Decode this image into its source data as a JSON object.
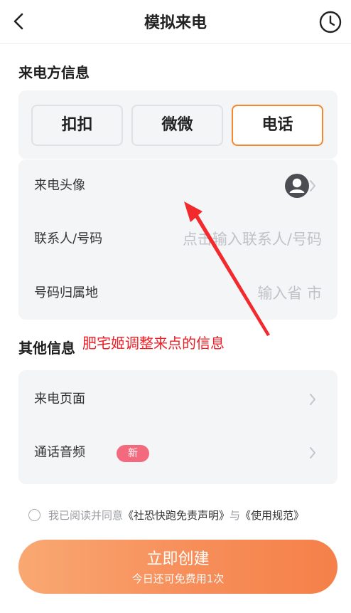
{
  "header": {
    "title": "模拟来电",
    "back_icon": "chevron-left-icon",
    "history_icon": "clock-icon"
  },
  "caller_section": {
    "title": "来电方信息",
    "tabs": [
      {
        "label": "扣扣",
        "selected": false
      },
      {
        "label": "微微",
        "selected": false
      },
      {
        "label": "电话",
        "selected": true
      }
    ],
    "avatar_row": {
      "label": "来电头像",
      "icon": "user-circle-icon"
    },
    "contact_row": {
      "label": "联系人/号码",
      "placeholder": "点击输入联系人/号码"
    },
    "location_row": {
      "label": "号码归属地",
      "placeholder": "输入省 市"
    }
  },
  "other_section": {
    "title": "其他信息",
    "page_row": {
      "label": "来电页面"
    },
    "audio_row": {
      "label": "通话音频",
      "badge": "新"
    }
  },
  "annotation": {
    "text": "肥宅姬调整来点的信息",
    "color": "#ee1d24"
  },
  "agreement": {
    "prefix": "我已阅读并同意",
    "link1": "《社恐快跑免责声明》",
    "middle": "与",
    "link2": "《使用规范》",
    "checked": false
  },
  "cta": {
    "label": "立即创建",
    "sub": "今日还可免费用1次"
  },
  "colors": {
    "accent": "#f5872f",
    "badge": "#f36a7e",
    "card_bg": "#f4f5f7"
  }
}
